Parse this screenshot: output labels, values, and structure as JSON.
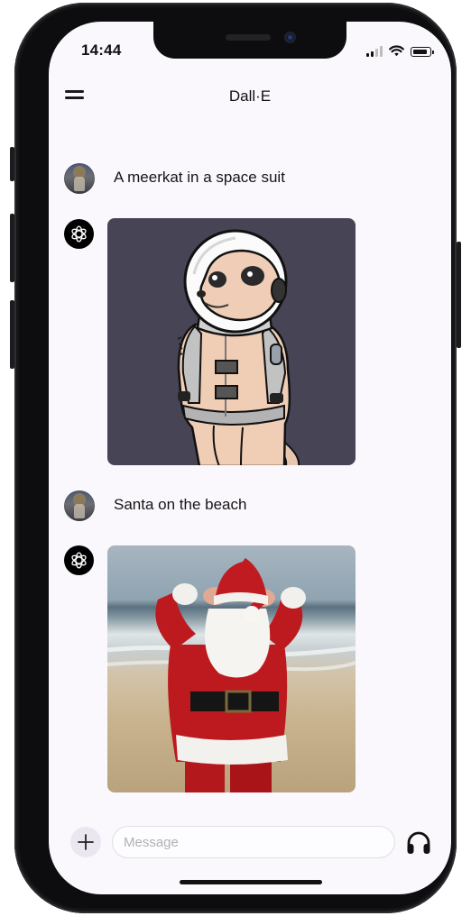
{
  "status_bar": {
    "time": "14:44"
  },
  "header": {
    "title": "Dall·E",
    "menu_icon": "hamburger-icon"
  },
  "messages": [
    {
      "role": "user",
      "text": "A meerkat in a space suit",
      "avatar": "user-avatar"
    },
    {
      "role": "assistant",
      "avatar": "openai-logo-icon",
      "image": "meerkat-astronaut"
    },
    {
      "role": "user",
      "text": "Santa on the beach",
      "avatar": "user-avatar"
    },
    {
      "role": "assistant",
      "avatar": "openai-logo-icon",
      "image": "santa-on-beach"
    }
  ],
  "composer": {
    "placeholder": "Message",
    "add_icon": "plus-icon",
    "voice_icon": "headphones-icon"
  },
  "colors": {
    "screen_background": "#faf8fc",
    "meerkat_background": "#474456",
    "santa_red": "#b8191d"
  }
}
